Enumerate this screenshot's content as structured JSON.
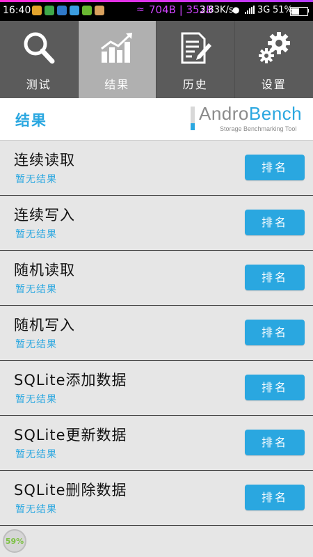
{
  "status_bar": {
    "time": "16:40",
    "memory": "704B | 352B",
    "speed": "3.83K/s",
    "network": "3G",
    "battery": "51%",
    "battery_level": 0.51
  },
  "tabs": [
    {
      "label": "测试",
      "icon": "magnifier-icon",
      "active": false
    },
    {
      "label": "结果",
      "icon": "bar-chart-icon",
      "active": true
    },
    {
      "label": "历史",
      "icon": "document-pencil-icon",
      "active": false
    },
    {
      "label": "设置",
      "icon": "gears-icon",
      "active": false
    }
  ],
  "header": {
    "title": "结果",
    "logo_andro": "Andro",
    "logo_bench": "Bench",
    "logo_tagline": "Storage Benchmarking Tool"
  },
  "results": [
    {
      "title": "连续读取",
      "status": "暂无结果",
      "button": "排名"
    },
    {
      "title": "连续写入",
      "status": "暂无结果",
      "button": "排名"
    },
    {
      "title": "随机读取",
      "status": "暂无结果",
      "button": "排名"
    },
    {
      "title": "随机写入",
      "status": "暂无结果",
      "button": "排名"
    },
    {
      "title": "SQLite添加数据",
      "status": "暂无结果",
      "button": "排名"
    },
    {
      "title": "SQLite更新数据",
      "status": "暂无结果",
      "button": "排名"
    },
    {
      "title": "SQLite删除数据",
      "status": "暂无结果",
      "button": "排名"
    }
  ],
  "floating_widget": {
    "percent": "59%"
  },
  "colors": {
    "accent": "#2aa7e0",
    "tabbar": "#5b5b5b",
    "tab_active": "#b0b0b0",
    "background": "#e6e6e6"
  }
}
